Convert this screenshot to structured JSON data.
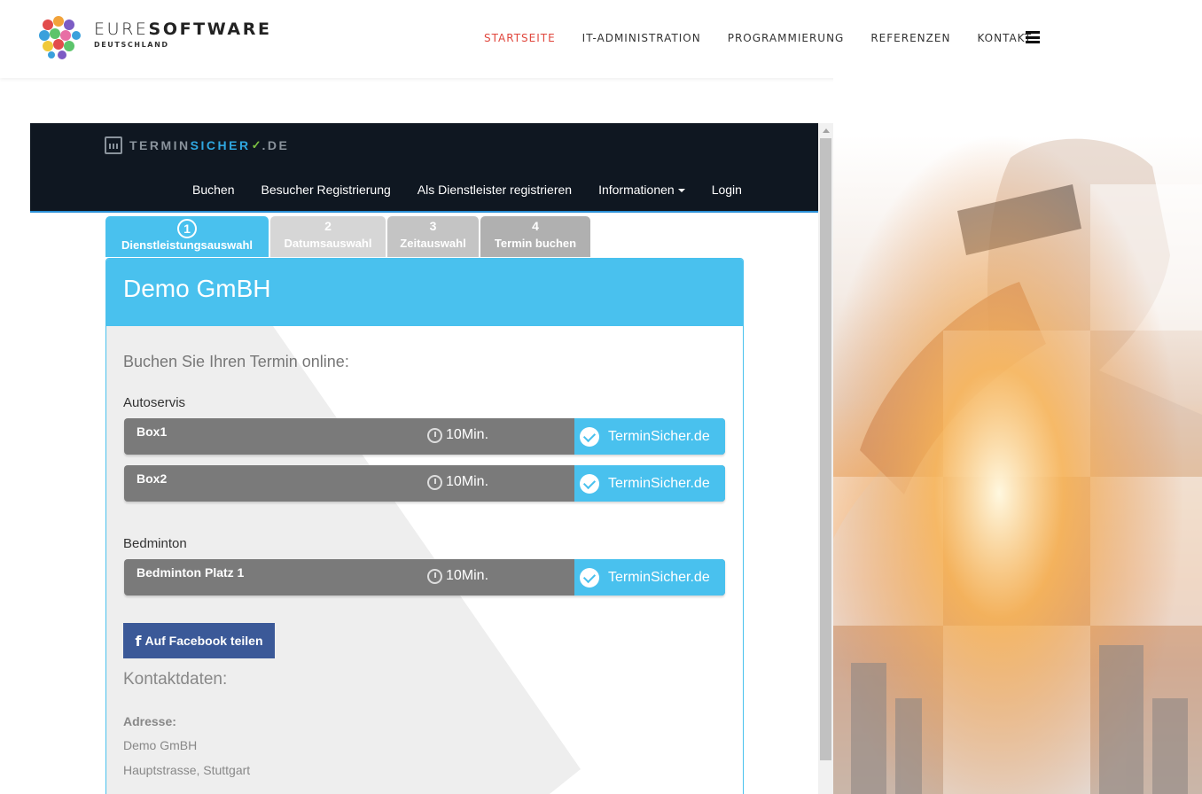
{
  "site": {
    "brand_light": "EURE",
    "brand_bold": "SOFTWARE",
    "brand_sub": "DEUTSCHLAND",
    "nav": [
      "STARTSEITE",
      "IT-ADMINISTRATION",
      "PROGRAMMIERUNG",
      "REFERENZEN",
      "KONTAKT"
    ],
    "active_nav": "STARTSEITE",
    "menu_icon": "hamburger-icon"
  },
  "terminsicher": {
    "logo_part1": "TERMIN",
    "logo_part2": "SICHER",
    "logo_part3": ".DE",
    "menu": [
      "Buchen",
      "Besucher Registrierung",
      "Als Dienstleister registrieren",
      "Informationen",
      "Login"
    ],
    "tabs": [
      {
        "num": "1",
        "label": "Dienstleistungsauswahl"
      },
      {
        "num": "2",
        "label": "Datumsauswahl"
      },
      {
        "num": "3",
        "label": "Zeitauswahl"
      },
      {
        "num": "4",
        "label": "Termin buchen"
      }
    ],
    "company": "Demo GmBH",
    "intro": "Buchen Sie Ihren Termin online:",
    "categories": [
      {
        "name": "Autoservis",
        "services": [
          {
            "name": "Box1",
            "duration": "10Min.",
            "book": "TerminSicher.de"
          },
          {
            "name": "Box2",
            "duration": "10Min.",
            "book": "TerminSicher.de"
          }
        ]
      },
      {
        "name": "Bedminton",
        "services": [
          {
            "name": "Bedminton Platz 1",
            "duration": "10Min.",
            "book": "TerminSicher.de"
          }
        ]
      }
    ],
    "facebook": "Auf Facebook teilen",
    "facebook_icon": "f",
    "contact_title": "Kontaktdaten:",
    "address_label": "Adresse:",
    "address_lines": [
      "Demo GmBH",
      "Hauptstrasse, Stuttgart"
    ]
  },
  "colors": {
    "accent": "#49c1ee",
    "nav_active": "#e0473d",
    "facebook": "#3b5998",
    "dark_nav": "#0f1721"
  }
}
